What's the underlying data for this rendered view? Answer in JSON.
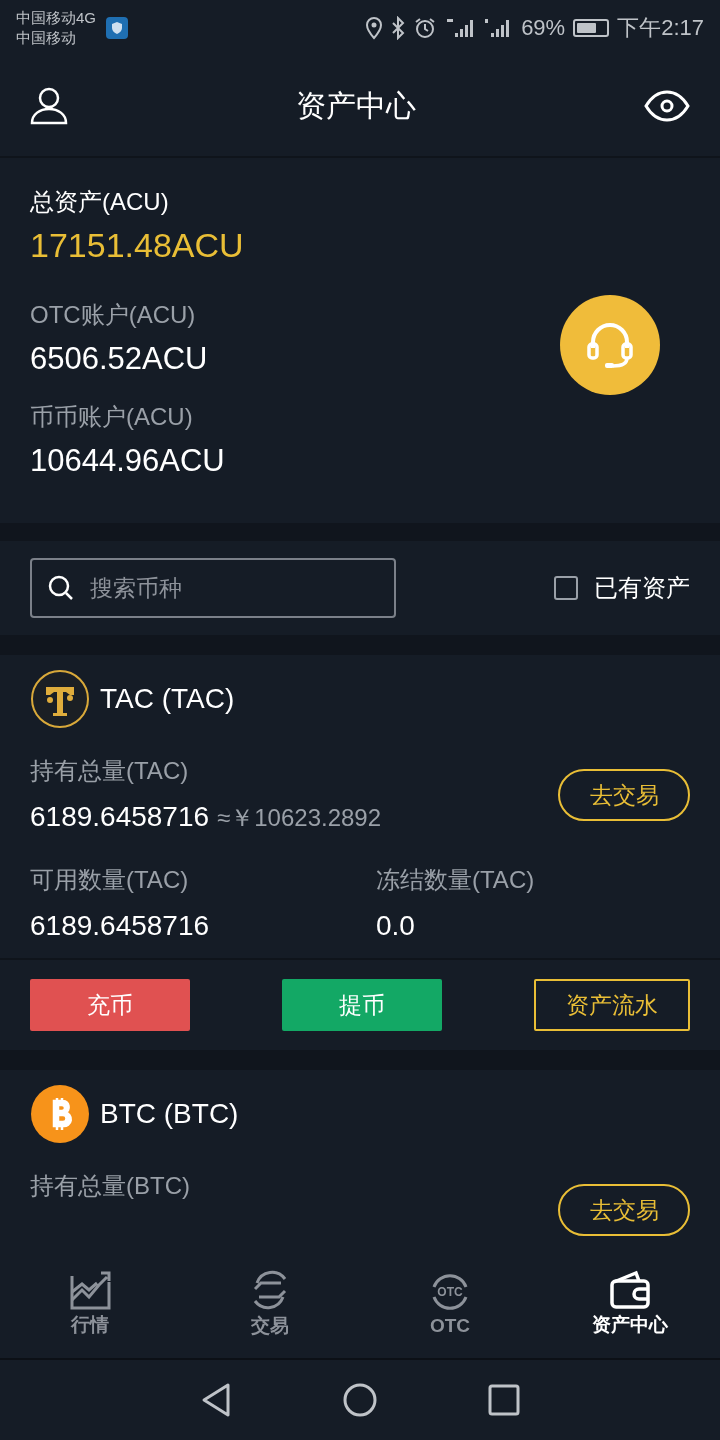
{
  "status_bar": {
    "carrier_1": "中国移动4G",
    "carrier_2": "中国移动",
    "battery_text": "69%",
    "time": "下午2:17"
  },
  "header": {
    "title": "资产中心"
  },
  "summary": {
    "total_label": "总资产(ACU)",
    "total_value": "17151.48ACU",
    "accounts": [
      {
        "label": "OTC账户(ACU)",
        "value": "6506.52ACU"
      },
      {
        "label": "币币账户(ACU)",
        "value": "10644.96ACU"
      }
    ]
  },
  "search": {
    "placeholder": "搜索币种"
  },
  "filter": {
    "label": "已有资产",
    "checked": false
  },
  "coins": [
    {
      "kind": "tac",
      "name": "TAC (TAC)",
      "holding_label": "持有总量(TAC)",
      "holding_value": "6189.6458716",
      "approx": "≈￥10623.2892",
      "trade_button": "去交易",
      "available_label": "可用数量(TAC)",
      "available_value": "6189.6458716",
      "frozen_label": "冻结数量(TAC)",
      "frozen_value": "0.0",
      "actions": [
        "充币",
        "提币",
        "资产流水"
      ]
    },
    {
      "kind": "btc",
      "name": "BTC (BTC)",
      "holding_label": "持有总量(BTC)",
      "trade_button": "去交易"
    }
  ],
  "tabs": [
    {
      "kind": "chart",
      "label": "行情",
      "selected": false
    },
    {
      "kind": "exchange",
      "label": "交易",
      "selected": false
    },
    {
      "kind": "otc",
      "label": "OTC",
      "icon_text": "OTC",
      "selected": false
    },
    {
      "kind": "wallet",
      "label": "资产中心",
      "selected": true
    }
  ]
}
